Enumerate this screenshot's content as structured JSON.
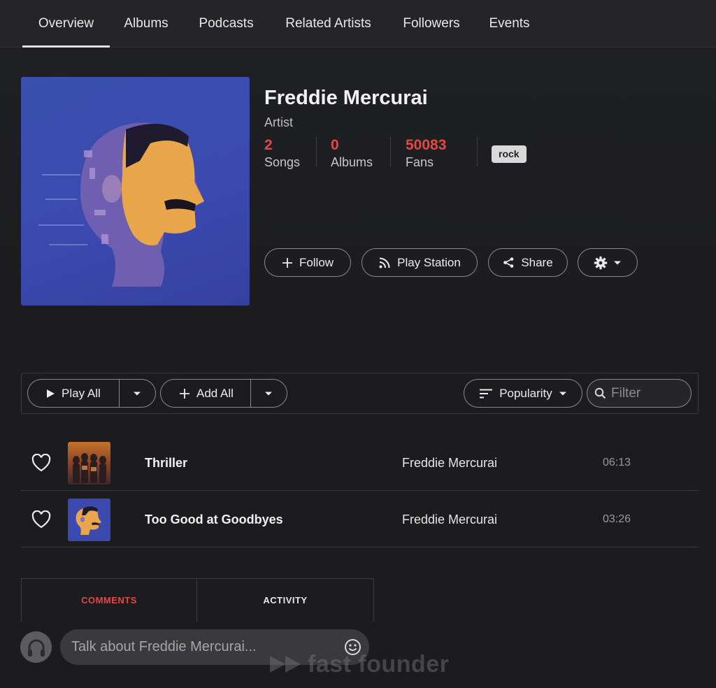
{
  "nav": {
    "tabs": [
      {
        "label": "Overview",
        "active": true
      },
      {
        "label": "Albums"
      },
      {
        "label": "Podcasts"
      },
      {
        "label": "Related Artists"
      },
      {
        "label": "Followers"
      },
      {
        "label": "Events"
      }
    ]
  },
  "artist": {
    "name": "Freddie Mercurai",
    "type": "Artist",
    "stats": [
      {
        "value": "2",
        "label": "Songs"
      },
      {
        "value": "0",
        "label": "Albums"
      },
      {
        "value": "50083",
        "label": "Fans"
      }
    ],
    "tag": "rock"
  },
  "actions": {
    "follow": "Follow",
    "play_station": "Play Station",
    "share": "Share",
    "settings_icon": "gear-icon"
  },
  "toolbar": {
    "play_all": "Play All",
    "add_all": "Add All",
    "sort": "Popularity",
    "filter_placeholder": "Filter"
  },
  "tracks": [
    {
      "title": "Thriller",
      "artist": "Freddie Mercurai",
      "duration": "06:13"
    },
    {
      "title": "Too Good at Goodbyes",
      "artist": "Freddie Mercurai",
      "duration": "03:26"
    }
  ],
  "comments": {
    "tabs": [
      {
        "label": "COMMENTS",
        "active": true
      },
      {
        "label": "ACTIVITY"
      }
    ],
    "input_placeholder": "Talk about Freddie Mercurai..."
  },
  "watermark": "fast founder",
  "colors": {
    "accent": "#e24848",
    "background": "#1c1c1e",
    "artwork_blue": "#3c4ab0"
  }
}
